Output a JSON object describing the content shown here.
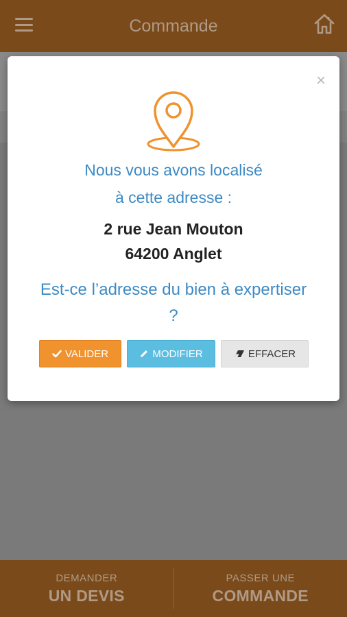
{
  "header": {
    "title": "Commande",
    "menu_icon": "hamburger-icon",
    "home_icon": "home-icon"
  },
  "modal": {
    "close_label": "×",
    "located_line1": "Nous vous avons localisé",
    "located_line2": "à cette adresse :",
    "address_line1": "2 rue Jean Mouton",
    "address_line2": "64200 Anglet",
    "question_line1": "Est-ce l’adresse du bien à expertiser",
    "question_line2": "?",
    "buttons": {
      "validate": "VALIDER",
      "modify": "MODIFIER",
      "clear": "EFFACER"
    }
  },
  "footer": {
    "left": {
      "small": "DEMANDER",
      "big": "UN DEVIS"
    },
    "right": {
      "small": "PASSER UNE",
      "big": "COMMANDE"
    }
  },
  "colors": {
    "brand_brown": "#7a4a1a",
    "accent_orange": "#f0922e",
    "info_blue": "#5bbde0",
    "text_blue": "#3d8ac4"
  }
}
